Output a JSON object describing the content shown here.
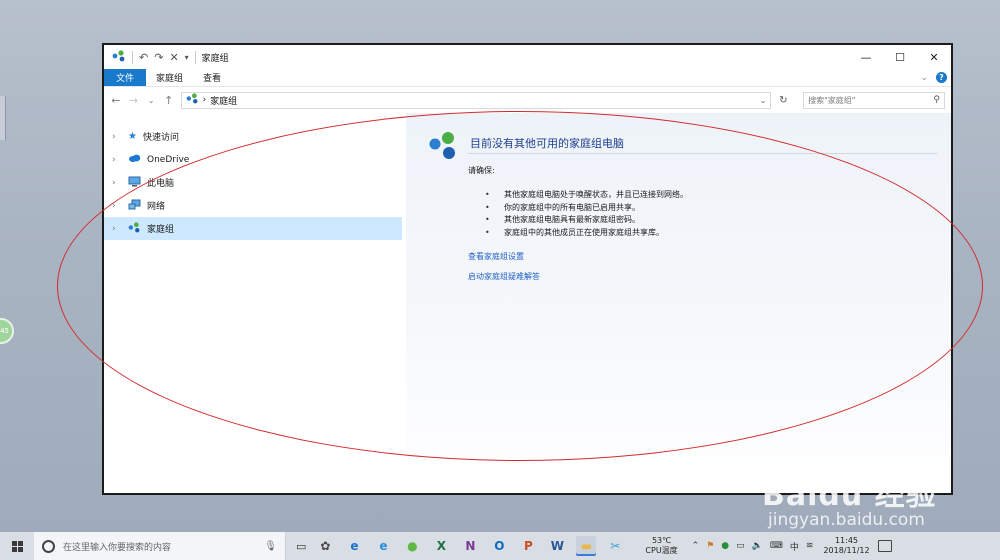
{
  "window": {
    "title": "家庭组",
    "controls": {
      "minimize": "—",
      "maximize": "☐",
      "close": "✕"
    }
  },
  "ribbon": {
    "tabs": [
      {
        "label": "文件"
      },
      {
        "label": "家庭组"
      },
      {
        "label": "查看"
      }
    ]
  },
  "address": {
    "separator": "›",
    "path": "家庭组",
    "search_placeholder": "搜索\"家庭组\""
  },
  "nav": {
    "items": [
      {
        "label": "快速访问"
      },
      {
        "label": "OneDrive"
      },
      {
        "label": "此电脑"
      },
      {
        "label": "网络"
      },
      {
        "label": "家庭组"
      }
    ]
  },
  "main": {
    "heading": "目前没有其他可用的家庭组电脑",
    "ensure": "请确保:",
    "bullets": [
      "其他家庭组电脑处于唤醒状态，并且已连接到网络。",
      "你的家庭组中的所有电脑已启用共享。",
      "其他家庭组电脑具有最新家庭组密码。",
      "家庭组中的其他成员正在使用家庭组共享库。"
    ],
    "links": [
      "查看家庭组设置",
      "启动家庭组疑难解答"
    ]
  },
  "taskbar": {
    "search_placeholder": "在这里输入你要搜索的内容",
    "apps": [
      {
        "icon": "fan-icon",
        "label": "✿",
        "color": "#4a4a4a"
      },
      {
        "icon": "edge-icon",
        "label": "e",
        "color": "#1b73c9"
      },
      {
        "icon": "ie-icon",
        "label": "e",
        "color": "#2a8fd8"
      },
      {
        "icon": "360-icon",
        "label": "●",
        "color": "#5fb846"
      },
      {
        "icon": "excel-icon",
        "label": "X",
        "color": "#1e7145"
      },
      {
        "icon": "onenote-icon",
        "label": "N",
        "color": "#7b3a96"
      },
      {
        "icon": "outlook-icon",
        "label": "O",
        "color": "#0f6abf"
      },
      {
        "icon": "powerpoint-icon",
        "label": "P",
        "color": "#c94f25"
      },
      {
        "icon": "word-icon",
        "label": "W",
        "color": "#2b5797"
      },
      {
        "icon": "explorer-icon",
        "label": "▬",
        "color": "#e8b949"
      },
      {
        "icon": "snipping-icon",
        "label": "✂",
        "color": "#3aa2c8"
      }
    ],
    "temperature": "53℃",
    "temperature_label": "CPU温度",
    "ime": "中",
    "time": "11:45",
    "date": "2018/11/12"
  },
  "overlay": {
    "watermark": "Baidu 经验",
    "watermark_sub": "jingyan.baidu.com",
    "edge_widget": "45"
  },
  "colors": {
    "accent": "#1979ca",
    "link": "#1f5fc3",
    "heading": "#1e3e8f",
    "selection": "#cde8ff",
    "annotation": "#d32b2b"
  }
}
